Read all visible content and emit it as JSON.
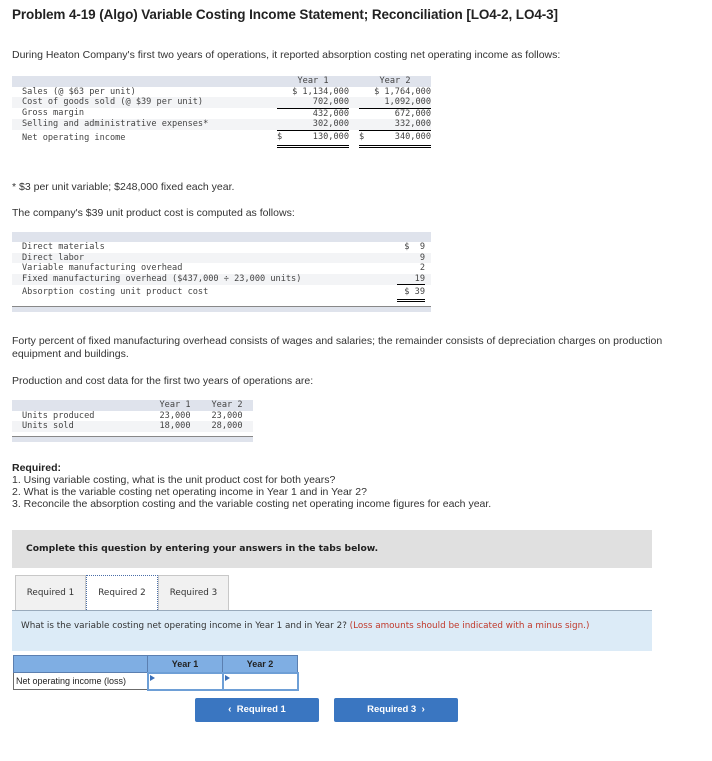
{
  "title": "Problem 4-19 (Algo) Variable Costing Income Statement; Reconciliation [LO4-2, LO4-3]",
  "intro": "During Heaton Company's first two years of operations, it reported absorption costing net operating income as follows:",
  "income_statement": {
    "headers": [
      "",
      "Year 1",
      "Year 2"
    ],
    "rows": [
      {
        "label": "Sales (@ $63 per unit)",
        "y1": "$ 1,134,000",
        "y2": "$ 1,764,000"
      },
      {
        "label": "Cost of goods sold (@ $39 per unit)",
        "y1": "702,000",
        "y2": "1,092,000"
      },
      {
        "label": "Gross margin",
        "y1": "432,000",
        "y2": "672,000"
      },
      {
        "label": "Selling and administrative expenses*",
        "y1": "302,000",
        "y2": "332,000"
      },
      {
        "label": "Net operating income",
        "y1_sign": "$",
        "y1": "130,000",
        "y2_sign": "$",
        "y2": "340,000"
      }
    ]
  },
  "footnote": "* $3 per unit variable; $248,000 fixed each year.",
  "unit_cost_intro": "The company's $39 unit product cost is computed as follows:",
  "unit_cost": {
    "rows": [
      {
        "label": "Direct materials",
        "value": "$  9"
      },
      {
        "label": "Direct labor",
        "value": "9"
      },
      {
        "label": "Variable manufacturing overhead",
        "value": "2"
      },
      {
        "label": "Fixed manufacturing overhead ($437,000 ÷ 23,000 units)",
        "value": "19"
      },
      {
        "label": "Absorption costing unit product cost",
        "value": "$ 39"
      }
    ]
  },
  "fixed_overhead_note": "Forty percent of fixed manufacturing overhead consists of wages and salaries; the remainder consists of depreciation charges on production equipment and buildings.",
  "production_intro": "Production and cost data for the first two years of operations are:",
  "production": {
    "headers": [
      "",
      "Year 1",
      "Year 2"
    ],
    "rows": [
      {
        "label": "Units produced",
        "y1": "23,000",
        "y2": "23,000"
      },
      {
        "label": "Units sold",
        "y1": "18,000",
        "y2": "28,000"
      }
    ]
  },
  "required": {
    "heading": "Required:",
    "items": [
      "1. Using variable costing, what is the unit product cost for both years?",
      "2. What is the variable costing net operating income in Year 1 and in Year 2?",
      "3. Reconcile the absorption costing and the variable costing net operating income figures for each year."
    ]
  },
  "complete_box": "Complete this question by entering your answers in the tabs below.",
  "tabs": [
    {
      "label": "Required 1",
      "active": false
    },
    {
      "label": "Required 2",
      "active": true
    },
    {
      "label": "Required 3",
      "active": false
    }
  ],
  "question": {
    "text": "What is the variable costing net operating income in Year 1 and in Year 2?",
    "note": "(Loss amounts should be indicated with a minus sign.)"
  },
  "answer_table": {
    "headers": [
      "",
      "Year 1",
      "Year 2"
    ],
    "row_label": "Net operating income (loss)",
    "year1_value": "",
    "year2_value": ""
  },
  "nav": {
    "prev_label": "Required 1",
    "next_label": "Required 3",
    "prev_icon": "‹",
    "next_icon": "›",
    "button_color": "#3a76c1"
  }
}
